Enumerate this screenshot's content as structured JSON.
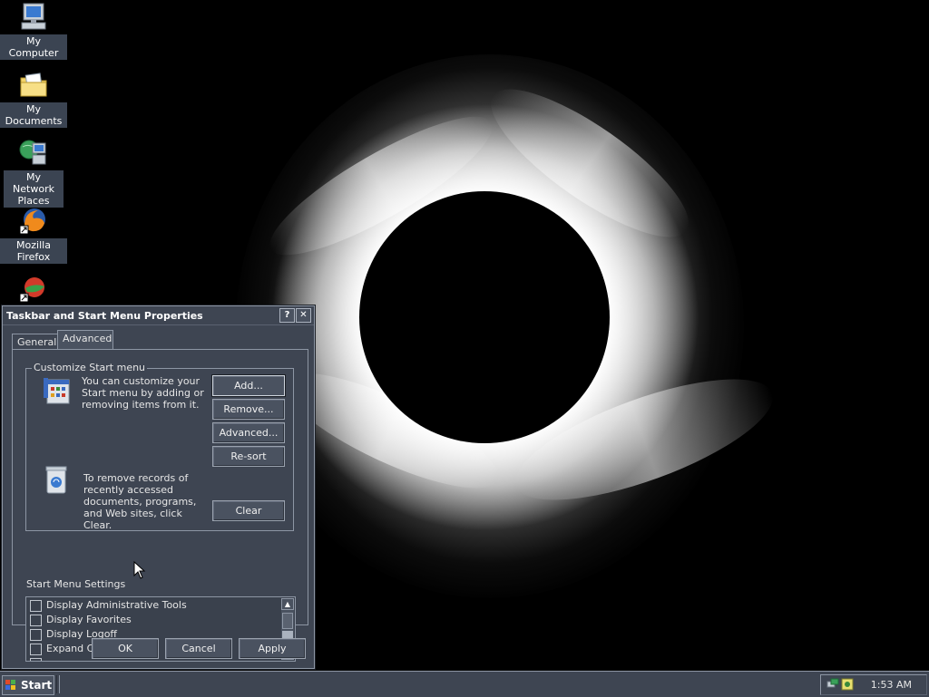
{
  "desktop": {
    "icons": [
      {
        "label": "My Computer"
      },
      {
        "label": "My Documents"
      },
      {
        "label": "My Network Places"
      },
      {
        "label": "Mozilla Firefox"
      },
      {
        "label": ""
      }
    ]
  },
  "dialog": {
    "title": "Taskbar and Start Menu Properties",
    "help_btn": "?",
    "close_btn": "✕",
    "tabs": [
      {
        "label": "General",
        "active": false
      },
      {
        "label": "Advanced",
        "active": true
      }
    ],
    "customize": {
      "group_label": "Customize Start menu",
      "description": "You can customize your Start menu by adding or removing items from it.",
      "buttons": [
        "Add...",
        "Remove...",
        "Advanced...",
        "Re-sort"
      ]
    },
    "clear": {
      "description": "To remove records of recently accessed documents, programs, and Web sites,  click Clear.",
      "button": "Clear"
    },
    "settings": {
      "label": "Start Menu Settings",
      "items": [
        {
          "label": "Display Administrative Tools",
          "checked": false
        },
        {
          "label": "Display Favorites",
          "checked": false
        },
        {
          "label": "Display Logoff",
          "checked": false
        },
        {
          "label": "Expand Control Panel",
          "checked": false
        }
      ]
    },
    "footer": {
      "ok": "OK",
      "cancel": "Cancel",
      "apply": "Apply"
    }
  },
  "taskbar": {
    "start_label": "Start",
    "clock": "1:53 AM"
  }
}
